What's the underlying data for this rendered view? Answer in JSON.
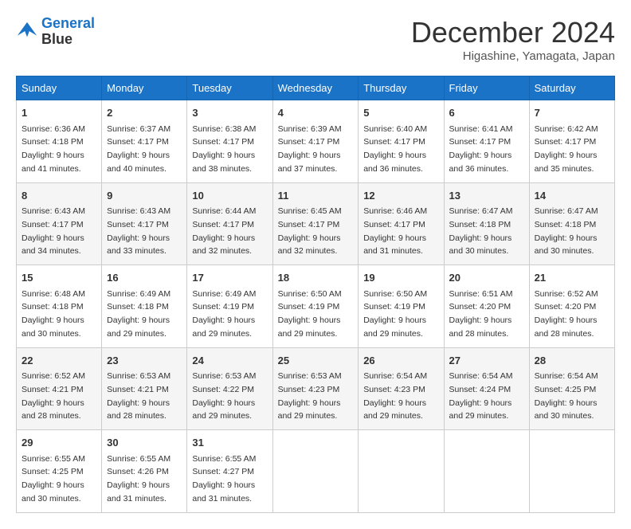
{
  "logo": {
    "line1": "General",
    "line2": "Blue"
  },
  "title": "December 2024",
  "subtitle": "Higashine, Yamagata, Japan",
  "weekdays": [
    "Sunday",
    "Monday",
    "Tuesday",
    "Wednesday",
    "Thursday",
    "Friday",
    "Saturday"
  ],
  "weeks": [
    [
      {
        "day": "1",
        "sunrise": "Sunrise: 6:36 AM",
        "sunset": "Sunset: 4:18 PM",
        "daylight": "Daylight: 9 hours and 41 minutes."
      },
      {
        "day": "2",
        "sunrise": "Sunrise: 6:37 AM",
        "sunset": "Sunset: 4:17 PM",
        "daylight": "Daylight: 9 hours and 40 minutes."
      },
      {
        "day": "3",
        "sunrise": "Sunrise: 6:38 AM",
        "sunset": "Sunset: 4:17 PM",
        "daylight": "Daylight: 9 hours and 38 minutes."
      },
      {
        "day": "4",
        "sunrise": "Sunrise: 6:39 AM",
        "sunset": "Sunset: 4:17 PM",
        "daylight": "Daylight: 9 hours and 37 minutes."
      },
      {
        "day": "5",
        "sunrise": "Sunrise: 6:40 AM",
        "sunset": "Sunset: 4:17 PM",
        "daylight": "Daylight: 9 hours and 36 minutes."
      },
      {
        "day": "6",
        "sunrise": "Sunrise: 6:41 AM",
        "sunset": "Sunset: 4:17 PM",
        "daylight": "Daylight: 9 hours and 36 minutes."
      },
      {
        "day": "7",
        "sunrise": "Sunrise: 6:42 AM",
        "sunset": "Sunset: 4:17 PM",
        "daylight": "Daylight: 9 hours and 35 minutes."
      }
    ],
    [
      {
        "day": "8",
        "sunrise": "Sunrise: 6:43 AM",
        "sunset": "Sunset: 4:17 PM",
        "daylight": "Daylight: 9 hours and 34 minutes."
      },
      {
        "day": "9",
        "sunrise": "Sunrise: 6:43 AM",
        "sunset": "Sunset: 4:17 PM",
        "daylight": "Daylight: 9 hours and 33 minutes."
      },
      {
        "day": "10",
        "sunrise": "Sunrise: 6:44 AM",
        "sunset": "Sunset: 4:17 PM",
        "daylight": "Daylight: 9 hours and 32 minutes."
      },
      {
        "day": "11",
        "sunrise": "Sunrise: 6:45 AM",
        "sunset": "Sunset: 4:17 PM",
        "daylight": "Daylight: 9 hours and 32 minutes."
      },
      {
        "day": "12",
        "sunrise": "Sunrise: 6:46 AM",
        "sunset": "Sunset: 4:17 PM",
        "daylight": "Daylight: 9 hours and 31 minutes."
      },
      {
        "day": "13",
        "sunrise": "Sunrise: 6:47 AM",
        "sunset": "Sunset: 4:18 PM",
        "daylight": "Daylight: 9 hours and 30 minutes."
      },
      {
        "day": "14",
        "sunrise": "Sunrise: 6:47 AM",
        "sunset": "Sunset: 4:18 PM",
        "daylight": "Daylight: 9 hours and 30 minutes."
      }
    ],
    [
      {
        "day": "15",
        "sunrise": "Sunrise: 6:48 AM",
        "sunset": "Sunset: 4:18 PM",
        "daylight": "Daylight: 9 hours and 30 minutes."
      },
      {
        "day": "16",
        "sunrise": "Sunrise: 6:49 AM",
        "sunset": "Sunset: 4:18 PM",
        "daylight": "Daylight: 9 hours and 29 minutes."
      },
      {
        "day": "17",
        "sunrise": "Sunrise: 6:49 AM",
        "sunset": "Sunset: 4:19 PM",
        "daylight": "Daylight: 9 hours and 29 minutes."
      },
      {
        "day": "18",
        "sunrise": "Sunrise: 6:50 AM",
        "sunset": "Sunset: 4:19 PM",
        "daylight": "Daylight: 9 hours and 29 minutes."
      },
      {
        "day": "19",
        "sunrise": "Sunrise: 6:50 AM",
        "sunset": "Sunset: 4:19 PM",
        "daylight": "Daylight: 9 hours and 29 minutes."
      },
      {
        "day": "20",
        "sunrise": "Sunrise: 6:51 AM",
        "sunset": "Sunset: 4:20 PM",
        "daylight": "Daylight: 9 hours and 28 minutes."
      },
      {
        "day": "21",
        "sunrise": "Sunrise: 6:52 AM",
        "sunset": "Sunset: 4:20 PM",
        "daylight": "Daylight: 9 hours and 28 minutes."
      }
    ],
    [
      {
        "day": "22",
        "sunrise": "Sunrise: 6:52 AM",
        "sunset": "Sunset: 4:21 PM",
        "daylight": "Daylight: 9 hours and 28 minutes."
      },
      {
        "day": "23",
        "sunrise": "Sunrise: 6:53 AM",
        "sunset": "Sunset: 4:21 PM",
        "daylight": "Daylight: 9 hours and 28 minutes."
      },
      {
        "day": "24",
        "sunrise": "Sunrise: 6:53 AM",
        "sunset": "Sunset: 4:22 PM",
        "daylight": "Daylight: 9 hours and 29 minutes."
      },
      {
        "day": "25",
        "sunrise": "Sunrise: 6:53 AM",
        "sunset": "Sunset: 4:23 PM",
        "daylight": "Daylight: 9 hours and 29 minutes."
      },
      {
        "day": "26",
        "sunrise": "Sunrise: 6:54 AM",
        "sunset": "Sunset: 4:23 PM",
        "daylight": "Daylight: 9 hours and 29 minutes."
      },
      {
        "day": "27",
        "sunrise": "Sunrise: 6:54 AM",
        "sunset": "Sunset: 4:24 PM",
        "daylight": "Daylight: 9 hours and 29 minutes."
      },
      {
        "day": "28",
        "sunrise": "Sunrise: 6:54 AM",
        "sunset": "Sunset: 4:25 PM",
        "daylight": "Daylight: 9 hours and 30 minutes."
      }
    ],
    [
      {
        "day": "29",
        "sunrise": "Sunrise: 6:55 AM",
        "sunset": "Sunset: 4:25 PM",
        "daylight": "Daylight: 9 hours and 30 minutes."
      },
      {
        "day": "30",
        "sunrise": "Sunrise: 6:55 AM",
        "sunset": "Sunset: 4:26 PM",
        "daylight": "Daylight: 9 hours and 31 minutes."
      },
      {
        "day": "31",
        "sunrise": "Sunrise: 6:55 AM",
        "sunset": "Sunset: 4:27 PM",
        "daylight": "Daylight: 9 hours and 31 minutes."
      },
      null,
      null,
      null,
      null
    ]
  ]
}
